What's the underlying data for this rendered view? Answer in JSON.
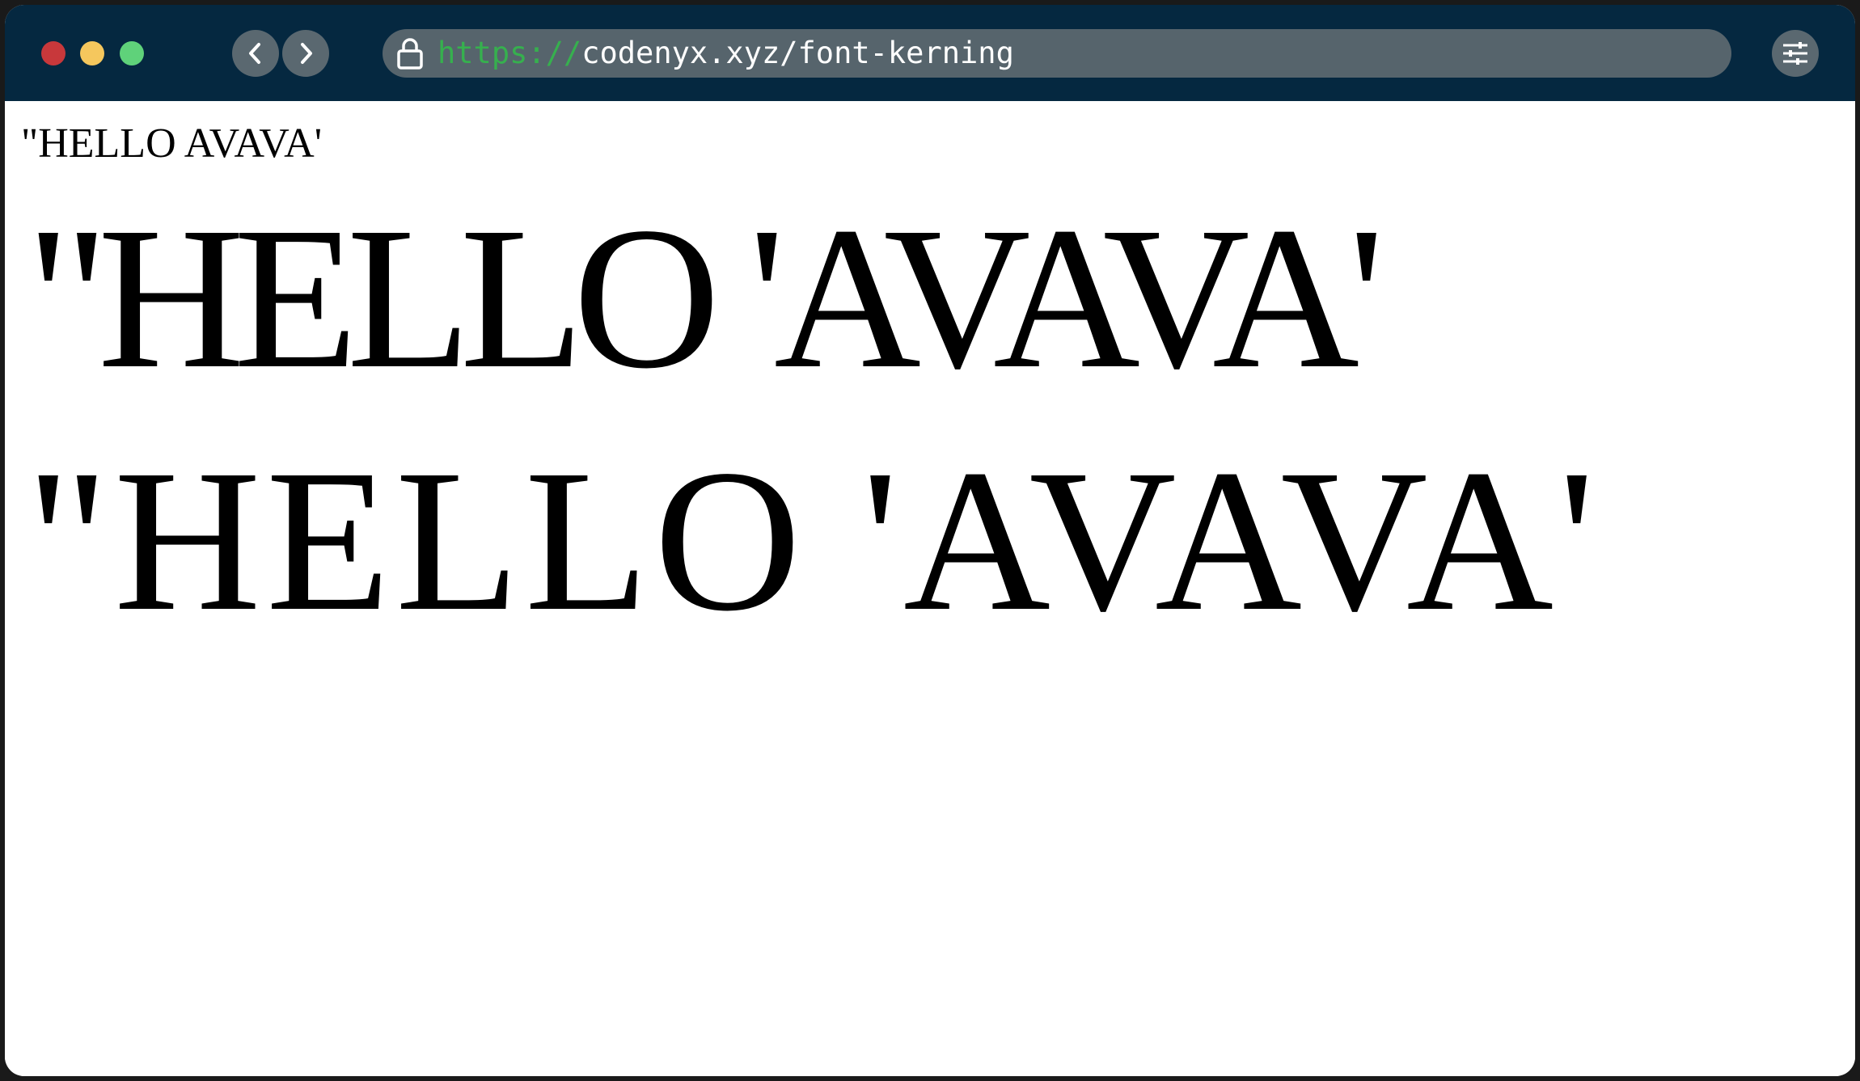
{
  "browser": {
    "url_scheme": "https://",
    "url_rest": "codenyx.xyz/font-kerning",
    "traffic_lights": [
      "#c8383b",
      "#f5c75d",
      "#5fd27a"
    ],
    "titlebar_color": "#052840",
    "icons": {
      "back": "chevron-left-icon",
      "forward": "chevron-right-icon",
      "lock": "lock-icon",
      "menu": "sliders-icon"
    }
  },
  "page": {
    "line_small": "\"HELLO AVAVA'",
    "line_big_1": "\"HELLO 'AVAVA'",
    "line_big_2": "\"HELLO 'AVAVA'"
  }
}
